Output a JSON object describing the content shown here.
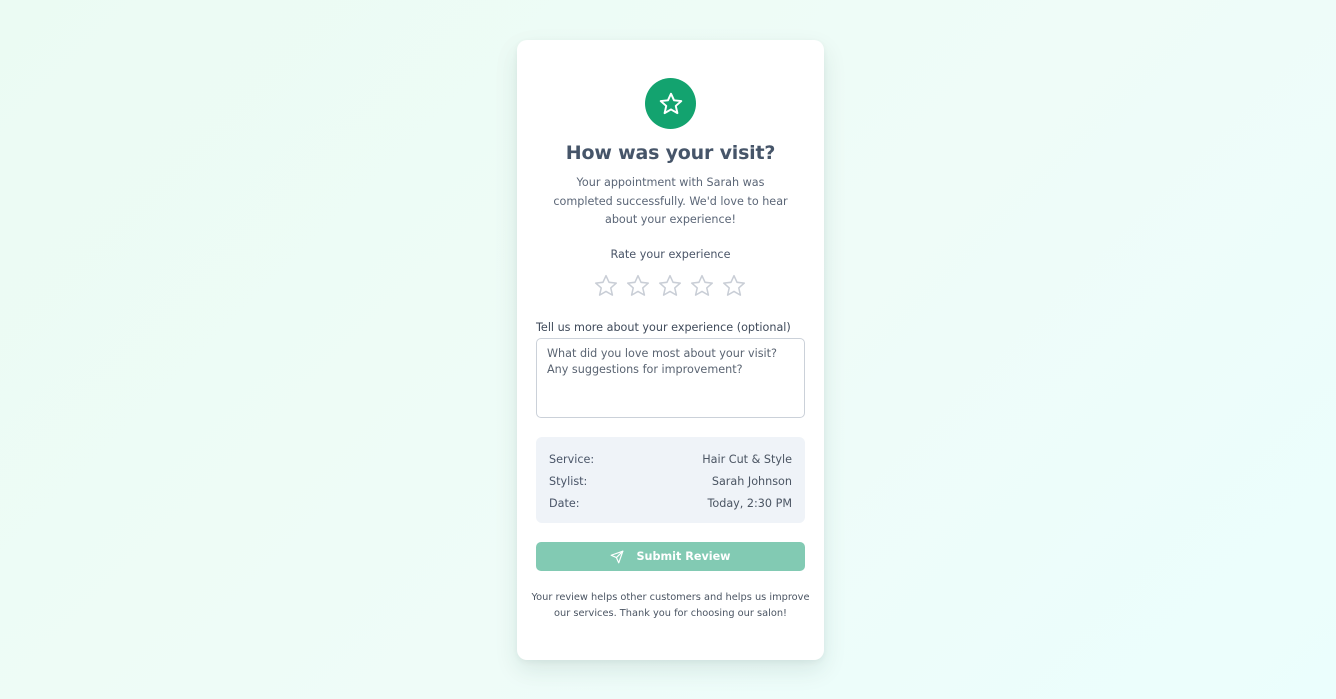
{
  "theme": {
    "accent": "#13a36f",
    "submit_disabled": "#82cab3",
    "star_outline": "#c9ced6"
  },
  "header": {
    "icon": "star-icon",
    "title": "How was your visit?",
    "subtitle": "Your appointment with Sarah was completed successfully. We'd love to hear about your experience!"
  },
  "rating": {
    "label": "Rate your experience",
    "max": 5,
    "selected": 0,
    "icon": "star-outline-icon"
  },
  "feedback": {
    "label": "Tell us more about your experience (optional)",
    "value": "",
    "placeholder": "What did you love most about your visit? Any suggestions for improvement?"
  },
  "details": [
    {
      "label": "Service:",
      "value": "Hair Cut & Style"
    },
    {
      "label": "Stylist:",
      "value": "Sarah Johnson"
    },
    {
      "label": "Date:",
      "value": "Today, 2:30 PM"
    }
  ],
  "submit": {
    "label": "Submit Review",
    "icon": "send-icon"
  },
  "footnote": "Your review helps other customers and helps us improve our services. Thank you for choosing our salon!"
}
